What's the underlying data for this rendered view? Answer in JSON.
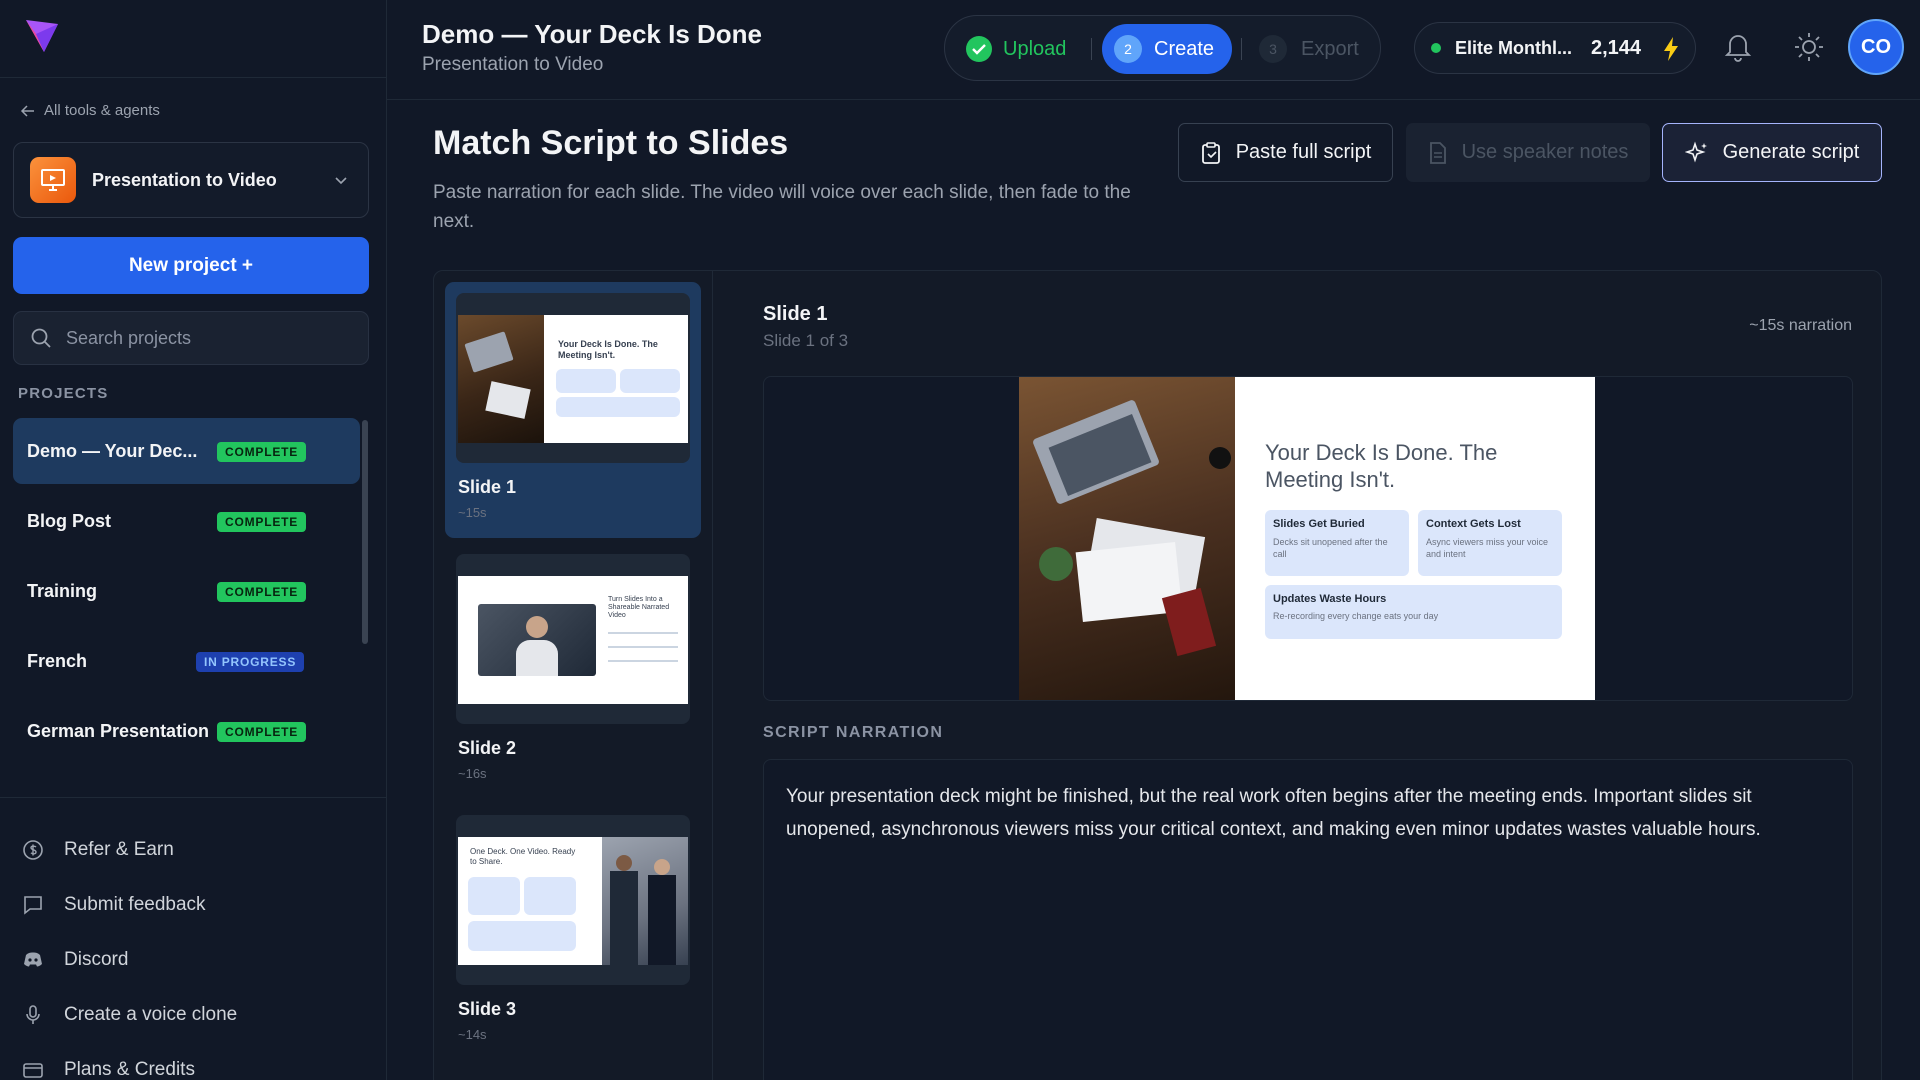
{
  "sidebar": {
    "back_link": "All tools & agents",
    "tool_name": "Presentation to Video",
    "new_project": "New project +",
    "search_placeholder": "Search projects",
    "projects_label": "PROJECTS",
    "projects": [
      {
        "name": "Demo — Your Dec...",
        "status": "COMPLETE"
      },
      {
        "name": "Blog Post",
        "status": "COMPLETE"
      },
      {
        "name": "Training",
        "status": "COMPLETE"
      },
      {
        "name": "French",
        "status": "IN PROGRESS"
      },
      {
        "name": "German Presentation",
        "status": "COMPLETE"
      }
    ],
    "links": [
      {
        "label": "Refer & Earn",
        "icon": "dollar-circle-icon"
      },
      {
        "label": "Submit feedback",
        "icon": "message-square-icon"
      },
      {
        "label": "Discord",
        "icon": "discord-icon"
      },
      {
        "label": "Create a voice clone",
        "icon": "microphone-icon"
      },
      {
        "label": "Plans & Credits",
        "icon": "credit-card-icon"
      }
    ]
  },
  "header": {
    "title": "Demo — Your Deck Is Done",
    "subtitle": "Presentation to Video",
    "steps": [
      {
        "label": "Upload",
        "state": "done"
      },
      {
        "num": "2",
        "label": "Create",
        "state": "active"
      },
      {
        "num": "3",
        "label": "Export",
        "state": "disabled"
      }
    ],
    "plan_name": "Elite Monthl...",
    "credits": "2,144",
    "avatar": "CO"
  },
  "main": {
    "title": "Match Script to Slides",
    "description": "Paste narration for each slide. The video will voice over each slide, then fade to the next.",
    "buttons": {
      "paste": "Paste full script",
      "notes": "Use speaker notes",
      "generate": "Generate script"
    },
    "slides": [
      {
        "title": "Slide 1",
        "duration": "~15s"
      },
      {
        "title": "Slide 2",
        "duration": "~16s"
      },
      {
        "title": "Slide 3",
        "duration": "~14s"
      }
    ],
    "detail": {
      "title": "Slide 1",
      "subtitle": "Slide 1 of 3",
      "narration": "~15s narration",
      "slide_heading": "Your Deck Is Done. The Meeting Isn't.",
      "cards": [
        {
          "title": "Slides Get Buried",
          "text": "Decks sit unopened after the call"
        },
        {
          "title": "Context Gets Lost",
          "text": "Async viewers miss your voice and intent"
        },
        {
          "title": "Updates Waste Hours",
          "text": "Re-recording every change eats your day"
        }
      ]
    },
    "script_label": "SCRIPT NARRATION",
    "script_text": "Your presentation deck might be finished, but the real work often begins after the meeting ends. Important slides sit unopened, asynchronous viewers miss your critical context, and making even minor updates wastes valuable hours."
  },
  "thumbs": {
    "slide2_heading": "Turn Slides Into a Shareable Narrated Video",
    "slide3_heading": "One Deck. One Video. Ready to Share."
  },
  "colors": {
    "accent": "#2563eb",
    "success": "#22c55e",
    "background": "#111827"
  }
}
